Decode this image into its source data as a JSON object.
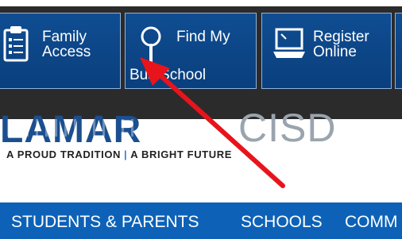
{
  "quick_links": [
    {
      "label": "Family\nAccess",
      "label_line1": "Family",
      "label_line2": "Access",
      "icon": "clipboard-icon"
    },
    {
      "label_line1": "Find My",
      "label_line2": "Bus/School",
      "icon": "magnifier-icon"
    },
    {
      "label_line1": "Register",
      "label_line2": "Online",
      "icon": "laptop-icon"
    }
  ],
  "logo": {
    "wordmark": "LAMAR",
    "suffix": "CISD",
    "tagline_left": "A PROUD TRADITION",
    "tagline_sep": "|",
    "tagline_right": "A BRIGHT FUTURE"
  },
  "nav": {
    "items": [
      "STUDENTS & PARENTS",
      "SCHOOLS",
      "COMM"
    ]
  },
  "colors": {
    "tile_blue": "#0a3f7d",
    "dark_bar": "#2b2b2b",
    "nav_blue": "#0d62b8",
    "arrow_red": "#e8141b"
  }
}
